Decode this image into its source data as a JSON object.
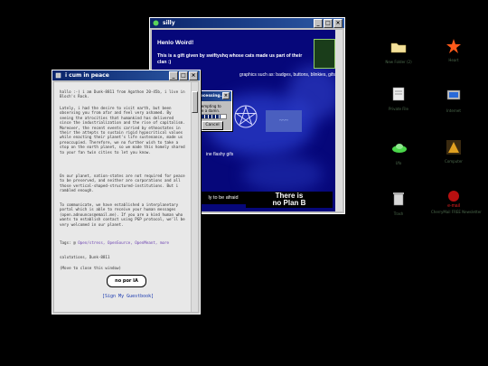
{
  "silly_window": {
    "title": "silly",
    "hello": "Henlo Woird!",
    "gift_text": "This is a gift given by swiftyshq whose cats made us part of their clan :)",
    "graphics_text": "graphics such as: badges, buttons, blinkies, gifs",
    "flashy_text": "ine flashy gifs",
    "afraid_banner": "ly to be afraid",
    "planb_line1": "There is",
    "planb_line2": "no Plan B"
  },
  "progress_dialog": {
    "title": "Processing...",
    "message": "Attempting to give a damn.",
    "progress": 0.8,
    "cancel_label": "Cancel"
  },
  "peace_window": {
    "title": "i cum in peace",
    "para1": "hallo :-) i am Dunk-8811 from Agathon 20-45b, i live in Bloch's Rock.",
    "para2": "Lately, i had the desire to visit earth, but been observing you from afar and feel very ashamed. By seeing the atrocities that humankind has delivered since the industrialization and the rise of capitalism. Moreover, the recent events carried by ethnostates in their the attepts to sustain rigid hypocritical values while enacting their planet's life sustenance, made us preoccupied. Therefore, we no further wish to take a stop on the earth planet, so we made this homely shared to your fan twin cities to let you know.",
    "para3": "On our planet, nation-states are not required for peace to be preserved, and neither are corporations and all those vertical-shaped-structured-institutions. But i rambled enough.",
    "para4": "To communicate, we have established a interplanetary portal which is able to receive your human messages (open.adnouncos@email.me). If you are a kind human who wants to establish contact using PGP protocol, we'll be very welcomed in our planet.",
    "tags_label": "Tags: @",
    "tags": "Open/stress, OpenSource, OpenMeant, more",
    "signoff": "salutations, Dunk-8811",
    "close_hint": "(Move to close this window)",
    "badge_text": "no por IA",
    "guestbook": "[Sign My Guestbook]"
  },
  "desktop_icons": [
    {
      "name": "folder-icon",
      "label": "New Folder (2)"
    },
    {
      "name": "star-icon",
      "label": "Heart"
    },
    {
      "name": "document-icon",
      "label": "Private File"
    },
    {
      "name": "pc-icon",
      "label": "Internet"
    },
    {
      "name": "ufo-icon",
      "label": "Ufo"
    },
    {
      "name": "program-icon",
      "label": "Computer"
    },
    {
      "name": "recycle-icon",
      "label": "Trash"
    },
    {
      "name": "email-icon",
      "label": "CherryMail FREE Newsletter"
    }
  ],
  "email_label": "e-mail",
  "colors": {
    "titlebar": "#0a246a",
    "silly_bg": "#06077a",
    "desktop": "#000000"
  }
}
